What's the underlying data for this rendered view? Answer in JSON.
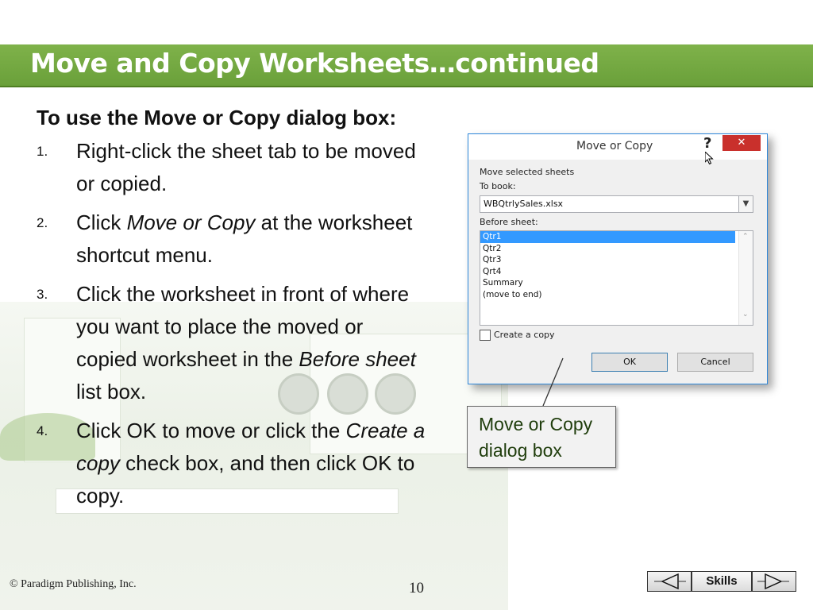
{
  "slide": {
    "title": "Move and Copy Worksheets…continued",
    "intro": "To use the Move or Copy dialog box:",
    "steps": [
      {
        "num": "1.",
        "text": "Right-click the sheet tab to be moved or copied."
      },
      {
        "num": "2.",
        "pre": "Click ",
        "em": "Move or Copy",
        "post": " at the worksheet shortcut menu."
      },
      {
        "num": "3.",
        "pre": "Click the worksheet in front of where you want to place the moved or copied worksheet in the ",
        "em": "Before sheet",
        "post": " list box."
      },
      {
        "num": "4.",
        "pre": "Click OK to move or click the ",
        "em": "Create a copy",
        "post": " check box, and then click OK to copy."
      }
    ]
  },
  "dialog": {
    "title": "Move or Copy",
    "help": "?",
    "close": "✕",
    "move_selected_label": "Move selected sheets",
    "to_book_label": "To book:",
    "to_book_value": "WBQtrlySales.xlsx",
    "before_sheet_label": "Before sheet:",
    "sheets": [
      "Qtr1",
      "Qtr2",
      "Qtr3",
      "Qrt4",
      "Summary",
      "(move to end)"
    ],
    "selected_sheet": "Qtr1",
    "create_copy_label": "Create a copy",
    "create_copy_checked": false,
    "ok_label": "OK",
    "cancel_label": "Cancel"
  },
  "callout": {
    "text": "Move or Copy dialog box"
  },
  "footer": {
    "copyright": "© Paradigm Publishing, Inc.",
    "page_number": "10",
    "skills_label": "Skills"
  },
  "colors": {
    "title_bar": "#6aa03a",
    "dialog_border": "#2d86d9",
    "close_button": "#c9302c",
    "selected_item": "#3399ff"
  }
}
